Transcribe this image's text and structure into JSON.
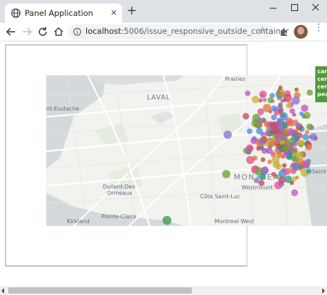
{
  "browser": {
    "tab_title": "Panel Application",
    "tab_close": "×",
    "new_tab": "+",
    "url_host": "localhost",
    "url_path": ":5006/issue_responsive_outside_container",
    "star": "☆"
  },
  "map": {
    "labels": {
      "prairies": "Prairies",
      "laval": "LAVAL",
      "sainte_eustache": "nt-Eustache",
      "dollard": "Dollard-Des",
      "ormeaux": "Ormeaux",
      "cote_saint_luc": "Côte Saint-Luc",
      "montreal": "MONTREAL",
      "westmount": "Westmount",
      "kirkland": "Kirkland",
      "pointe_claire": "Pointe-Claire",
      "montreal_west": "Montreal West",
      "saint_l": "Saint-L"
    },
    "tooltip_lines": [
      "car",
      "cer",
      "cer",
      "pea"
    ],
    "colors": {
      "tooltip": "#4e9b3a",
      "water": "#d4dadc",
      "land": "#f2f2ef"
    }
  }
}
